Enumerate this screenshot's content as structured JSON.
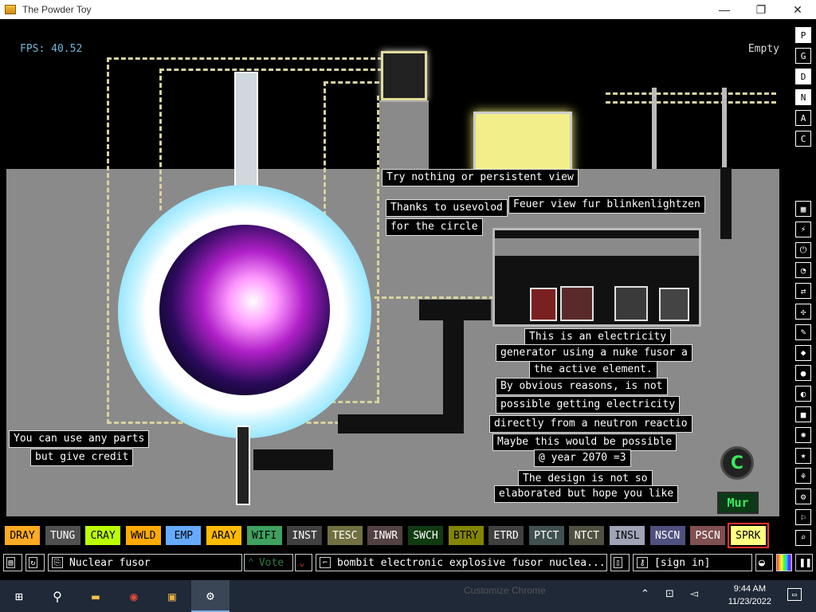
{
  "window": {
    "title": "The Powder Toy",
    "minimize": "—",
    "maximize": "❐",
    "close": "✕"
  },
  "hud": {
    "fps": "FPS: 40.52",
    "hover": "Empty"
  },
  "notes": [
    "Try nothing or persistent view",
    "Thanks to usevolod",
    "for the circle",
    "Feuer view fur blinkenlightzen",
    "This is an electricity",
    "generator using a nuke fusor a",
    "the active element.",
    "By obvious reasons, is not",
    "possible getting electricity",
    "directly from a neutron reactio",
    "Maybe this would be possible",
    "@ year 2070 =3",
    "The design is not so",
    "elaborated but hope you like",
    "You can use any parts",
    "but give credit"
  ],
  "badges": {
    "c": "C",
    "mur": "Mur"
  },
  "view_modes": [
    "P",
    "G",
    "D",
    "N",
    "A",
    "C"
  ],
  "menu_icons": [
    "tool-menu",
    "power-menu",
    "electronics-menu",
    "powered-menu",
    "sensors-menu",
    "force-menu",
    "explosives-menu",
    "gas-menu",
    "liquids-menu",
    "powders-menu",
    "solids-menu",
    "radioactive-menu",
    "special-menu",
    "life-menu",
    "tools-menu",
    "favorites-menu",
    "search-menu"
  ],
  "elements": [
    {
      "label": "DRAY",
      "bg": "#ffaa22",
      "fg": "#000"
    },
    {
      "label": "TUNG",
      "bg": "#505050",
      "fg": "#fff"
    },
    {
      "label": "CRAY",
      "bg": "#bbff00",
      "fg": "#000"
    },
    {
      "label": "WWLD",
      "bg": "#ffaa00",
      "fg": "#000"
    },
    {
      "label": "EMP",
      "bg": "#66aaff",
      "fg": "#000"
    },
    {
      "label": "ARAY",
      "bg": "#ffbb00",
      "fg": "#000"
    },
    {
      "label": "WIFI",
      "bg": "#40a060",
      "fg": "#000"
    },
    {
      "label": "INST",
      "bg": "#404040",
      "fg": "#fff"
    },
    {
      "label": "TESC",
      "bg": "#707040",
      "fg": "#fff"
    },
    {
      "label": "INWR",
      "bg": "#544141",
      "fg": "#fff"
    },
    {
      "label": "SWCH",
      "bg": "#103b11",
      "fg": "#fff"
    },
    {
      "label": "BTRY",
      "bg": "#858505",
      "fg": "#000"
    },
    {
      "label": "ETRD",
      "bg": "#404040",
      "fg": "#fff"
    },
    {
      "label": "PTCT",
      "bg": "#405050",
      "fg": "#fff"
    },
    {
      "label": "NTCT",
      "bg": "#505040",
      "fg": "#fff"
    },
    {
      "label": "INSL",
      "bg": "#9ea3b6",
      "fg": "#000"
    },
    {
      "label": "NSCN",
      "bg": "#505080",
      "fg": "#fff"
    },
    {
      "label": "PSCN",
      "bg": "#805050",
      "fg": "#fff"
    },
    {
      "label": "SPRK",
      "bg": "#ffff80",
      "fg": "#000"
    }
  ],
  "selected_element": "SPRK",
  "toolbar": {
    "save_name": "Nuclear fusor",
    "vote": "Vote",
    "tags": "bombit electronic explosive fusor nuclea...",
    "sign_in": "[sign in]"
  },
  "taskbar": {
    "ghost": "Customize Chrome",
    "time": "9:44 AM",
    "date": "11/23/2022"
  }
}
